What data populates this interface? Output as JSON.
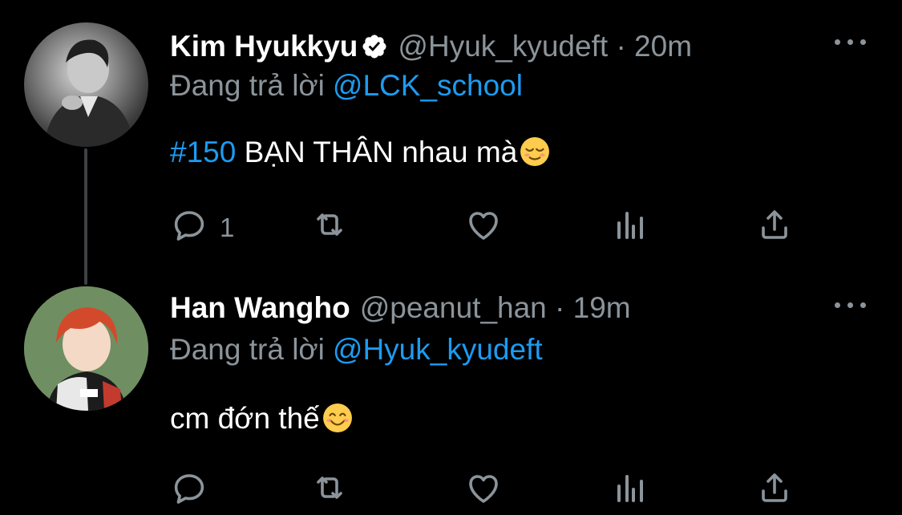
{
  "tweets": [
    {
      "display_name": "Kim Hyukkyu",
      "verified_icon": "verified-badge-icon",
      "handle": "@Hyuk_kyudeft",
      "separator": "·",
      "time": "20m",
      "reply_prefix": "Đang trả lời",
      "reply_to": "@LCK_school",
      "hashtag": "#150",
      "text": "BẠN THÂN nhau mà",
      "emoji": "relieved-face-emoji",
      "actions": {
        "reply_count": "1"
      }
    },
    {
      "display_name": "Han Wangho",
      "handle": "@peanut_han",
      "separator": "·",
      "time": "19m",
      "reply_prefix": "Đang trả lời",
      "reply_to": "@Hyuk_kyudeft",
      "text": "cm đớn thế",
      "emoji": "smiling-face-emoji",
      "actions": {
        "reply_count": ""
      }
    }
  ],
  "colors": {
    "background": "#000000",
    "primary_text": "#ffffff",
    "secondary_text": "#8b949a",
    "link_blue": "#1d9bf0",
    "thread_line": "#3e4144"
  }
}
